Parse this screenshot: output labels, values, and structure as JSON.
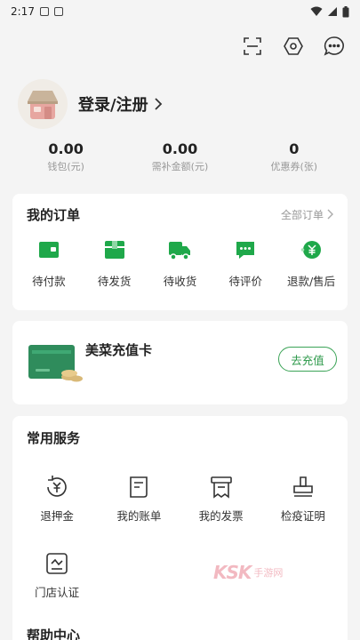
{
  "status_bar": {
    "time": "2:17"
  },
  "top_icons": [
    "scan-icon",
    "settings-icon",
    "message-icon"
  ],
  "profile": {
    "login_label": "登录/注册"
  },
  "wallet": [
    {
      "value": "0.00",
      "label": "钱包(元)"
    },
    {
      "value": "0.00",
      "label": "需补金额(元)"
    },
    {
      "value": "0",
      "label": "优惠券(张)"
    }
  ],
  "orders": {
    "title": "我的订单",
    "all_label": "全部订单",
    "items": [
      {
        "label": "待付款",
        "icon": "wallet-icon"
      },
      {
        "label": "待发货",
        "icon": "box-icon"
      },
      {
        "label": "待收货",
        "icon": "truck-icon"
      },
      {
        "label": "待评价",
        "icon": "comment-icon"
      },
      {
        "label": "退款/售后",
        "icon": "refund-icon"
      }
    ]
  },
  "recharge": {
    "title": "美菜充值卡",
    "button": "去充值"
  },
  "services": {
    "title": "常用服务",
    "items": [
      {
        "label": "退押金",
        "icon": "deposit-refund-icon"
      },
      {
        "label": "我的账单",
        "icon": "bill-icon"
      },
      {
        "label": "我的发票",
        "icon": "invoice-icon"
      },
      {
        "label": "检疫证明",
        "icon": "stamp-icon"
      },
      {
        "label": "门店认证",
        "icon": "store-verify-icon"
      }
    ]
  },
  "help": {
    "title": "帮助中心"
  },
  "watermark": {
    "brand": "KSK",
    "sub": "手游网"
  },
  "colors": {
    "accent": "#2f9a4c",
    "icon_green": "#1fa84a",
    "background": "#f4f4f4"
  }
}
